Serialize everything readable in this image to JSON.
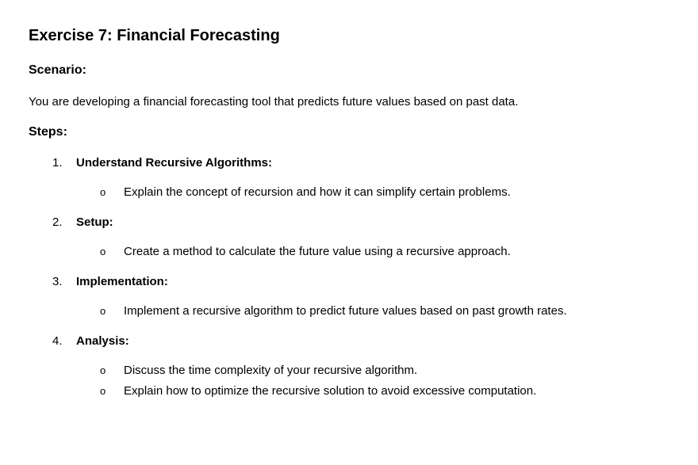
{
  "doc": {
    "title": "Exercise 7: Financial Forecasting",
    "scenario_heading": "Scenario:",
    "scenario_text": "You are developing a financial forecasting tool that predicts future values based on past data.",
    "steps_heading": "Steps:",
    "bullet_symbol": "o",
    "steps": [
      {
        "number": "1.",
        "label": "Understand Recursive Algorithms:",
        "bullets": [
          "Explain the concept of recursion and how it can simplify certain problems."
        ]
      },
      {
        "number": "2.",
        "label": "Setup:",
        "bullets": [
          "Create a method to calculate the future value using a recursive approach."
        ]
      },
      {
        "number": "3.",
        "label": "Implementation:",
        "bullets": [
          "Implement a recursive algorithm to predict future values based on past growth rates."
        ]
      },
      {
        "number": "4.",
        "label": "Analysis:",
        "bullets": [
          "Discuss the time complexity of your recursive algorithm.",
          "Explain how to optimize the recursive solution to avoid excessive computation."
        ]
      }
    ]
  }
}
